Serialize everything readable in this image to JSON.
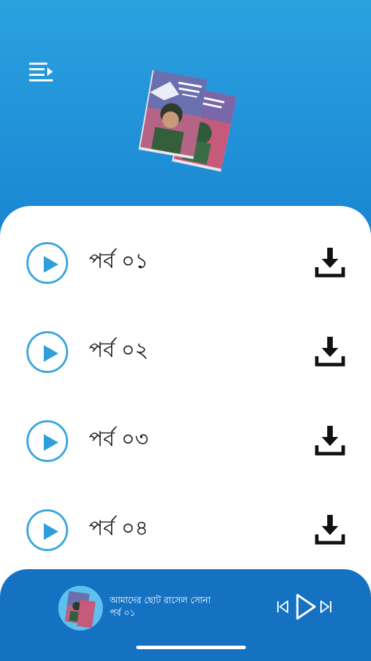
{
  "header": {
    "menu_icon": "menu-icon",
    "cover_icon": "book-cover-image"
  },
  "episodes": [
    {
      "label": "পর্ব ০১"
    },
    {
      "label": "পর্ব ০২"
    },
    {
      "label": "পর্ব ০৩"
    },
    {
      "label": "পর্ব ০৪"
    }
  ],
  "player": {
    "title": "আমাদের ছোট রাসেল সোনা",
    "subtitle": "পর্ব ০১"
  },
  "colors": {
    "accent": "#3aa6dd",
    "player_bg": "#1572c2",
    "header_top": "#2aa2df"
  }
}
